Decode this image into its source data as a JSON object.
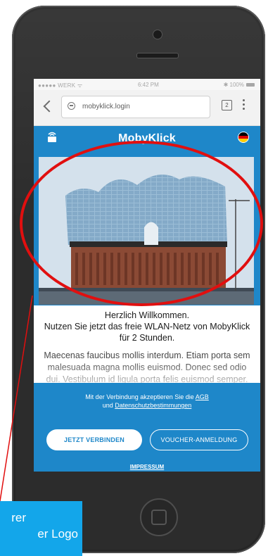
{
  "status_bar": {
    "carrier": "●●●●● WERK ᯤ",
    "time": "6:42 PM",
    "battery": "✱ 100%"
  },
  "browser": {
    "url": "mobyklick.login",
    "tab_count": "2"
  },
  "app": {
    "title": "MobyKlick",
    "flag_colors": [
      "#000000",
      "#dd0000",
      "#ffce00"
    ]
  },
  "content": {
    "welcome_line1": "Herzlich Willkommen.",
    "welcome_line2": "Nutzen Sie jetzt das freie WLAN-Netz von MobyKlick für 2 Stunden.",
    "lorem": "Maecenas faucibus mollis interdum. Etiam porta sem malesuada magna mollis euismod. Donec sed odio dui. Vestibulum id ligula porta felis euismod semper."
  },
  "footer": {
    "terms_prefix": "Mit der Verbindung akzeptieren Sie die ",
    "terms_agb": "AGB",
    "terms_and": "und ",
    "terms_privacy": "Datenschutzbestimmungen",
    "connect_button": "JETZT VERBINDEN",
    "voucher_button": "VOUCHER-ANMELDUNG",
    "impressum": "IMPRESSUM"
  },
  "annotation": {
    "callout_line1": "rer",
    "callout_line2": "er Logo",
    "color": "#e10f0f",
    "callout_bg": "#13a6ea"
  }
}
